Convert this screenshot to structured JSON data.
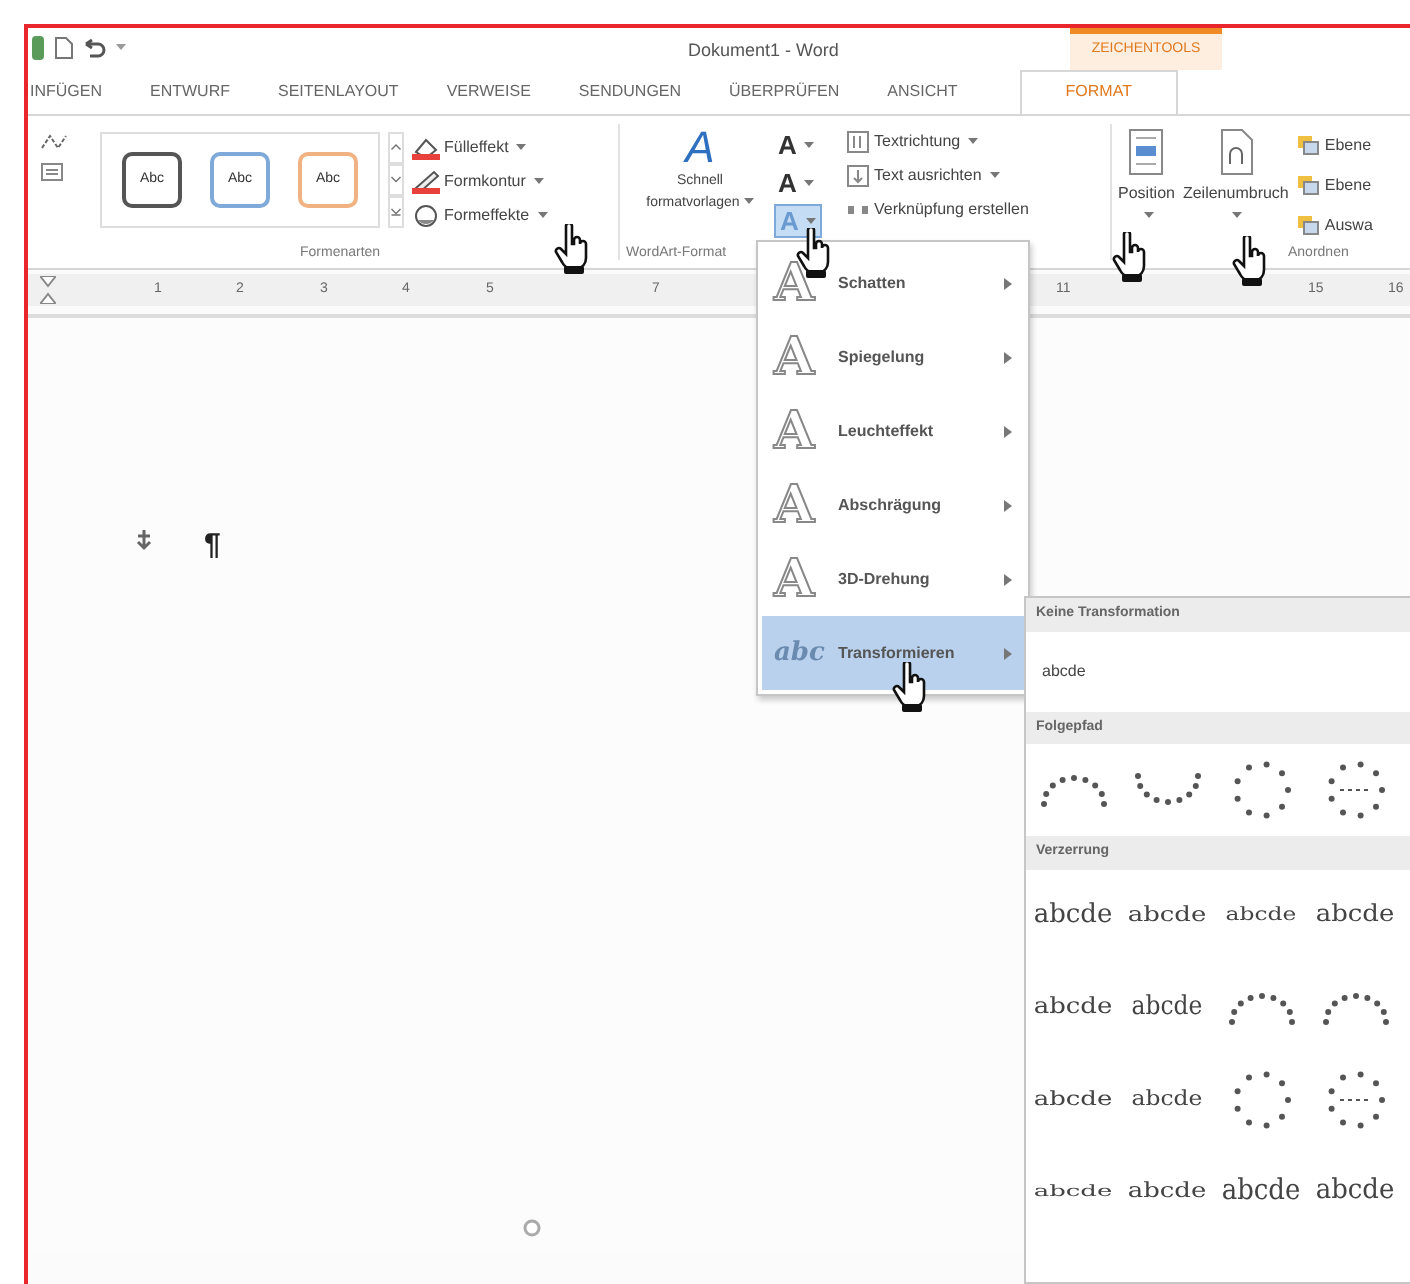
{
  "title_bar": {
    "title": "Dokument1 - Word",
    "context_tab": "ZEICHENTOOLS"
  },
  "tabs": [
    {
      "label": "INFÜGEN",
      "selected": false
    },
    {
      "label": "ENTWURF",
      "selected": false
    },
    {
      "label": "SEITENLAYOUT",
      "selected": false
    },
    {
      "label": "VERWEISE",
      "selected": false
    },
    {
      "label": "SENDUNGEN",
      "selected": false
    },
    {
      "label": "ÜBERPRÜFEN",
      "selected": false
    },
    {
      "label": "ANSICHT",
      "selected": false
    },
    {
      "label": "FORMAT",
      "selected": true
    }
  ],
  "ribbon": {
    "shape_styles": {
      "samples": [
        {
          "label": "Abc",
          "color": "#555555"
        },
        {
          "label": "Abc",
          "color": "#7fa9d8"
        },
        {
          "label": "Abc",
          "color": "#f0b283"
        }
      ],
      "commands": [
        {
          "label": "Fülleffekt",
          "kind": "fill"
        },
        {
          "label": "Formkontur",
          "kind": "outline"
        },
        {
          "label": "Formeffekte",
          "kind": "effects"
        }
      ],
      "group_label": "Formenarten"
    },
    "wordart": {
      "quick_styles": {
        "glyph": "A",
        "lines": [
          "Schnell",
          "formatvorlagen"
        ]
      },
      "text_buttons": [
        {
          "glyph": "A",
          "pressed": false
        },
        {
          "glyph": "A",
          "pressed": false
        },
        {
          "glyph": "A",
          "pressed": true
        }
      ],
      "group_label": "WordArt-Format"
    },
    "text": {
      "commands": [
        {
          "label": "Textrichtung",
          "caret": true
        },
        {
          "label": "Text ausrichten",
          "caret": true
        },
        {
          "label": "Verknüpfung erstellen",
          "caret": false
        }
      ]
    },
    "arrange": {
      "big": [
        "Position",
        "Zeilenumbruch"
      ],
      "small": [
        "Ebene",
        "Ebene",
        "Auswa"
      ],
      "group_label": "Anordnen"
    }
  },
  "ruler": {
    "marks": [
      "1",
      "2",
      "3",
      "4",
      "5",
      "7",
      "11",
      "15",
      "16"
    ]
  },
  "document": {
    "paragraph_mark": "¶"
  },
  "effects_menu": {
    "items": [
      {
        "icon": "A",
        "label": "Schatten",
        "selected": false
      },
      {
        "icon": "A",
        "label": "Spiegelung",
        "selected": false
      },
      {
        "icon": "A",
        "label": "Leuchteffekt",
        "selected": false
      },
      {
        "icon": "A",
        "label": "Abschrägung",
        "selected": false
      },
      {
        "icon": "A",
        "label": "3D-Drehung",
        "selected": false
      },
      {
        "icon": "abc",
        "label": "Transformieren",
        "selected": true
      }
    ]
  },
  "transform_gallery": {
    "sections": [
      {
        "header": "Keine Transformation",
        "items": [
          {
            "kind": "text",
            "label": "abcde"
          }
        ]
      },
      {
        "header": "Folgepfad",
        "items": [
          {
            "kind": "arch-up"
          },
          {
            "kind": "arch-down"
          },
          {
            "kind": "circle"
          },
          {
            "kind": "button"
          }
        ]
      },
      {
        "header": "Verzerrung",
        "items": [
          {
            "kind": "text",
            "label": "abcde"
          },
          {
            "kind": "text",
            "label": "abcde"
          },
          {
            "kind": "text",
            "label": "abcde"
          },
          {
            "kind": "text",
            "label": "abcde"
          },
          {
            "kind": "text",
            "label": "abcde"
          },
          {
            "kind": "text",
            "label": "abcde"
          },
          {
            "kind": "arch-up"
          },
          {
            "kind": "arch-up"
          },
          {
            "kind": "text",
            "label": "abcde"
          },
          {
            "kind": "text",
            "label": "abcde"
          },
          {
            "kind": "circle"
          },
          {
            "kind": "button"
          },
          {
            "kind": "text",
            "label": "abcde"
          },
          {
            "kind": "text",
            "label": "abcde"
          },
          {
            "kind": "text",
            "label": "abcde"
          },
          {
            "kind": "text",
            "label": "abcde"
          }
        ]
      }
    ]
  }
}
